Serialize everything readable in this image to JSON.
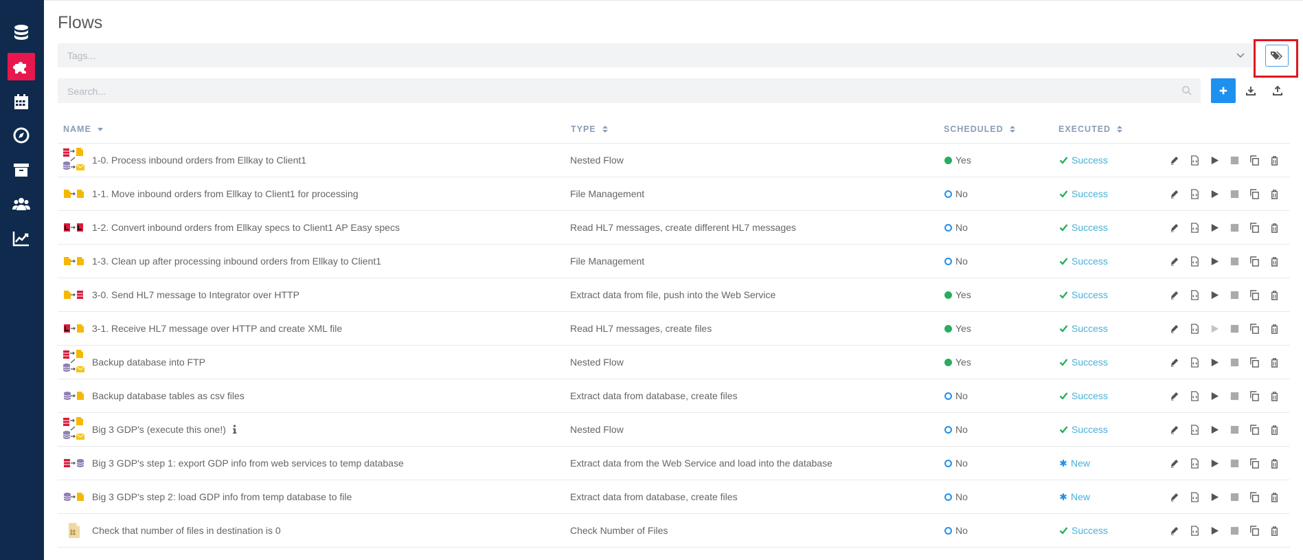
{
  "page": {
    "title": "Flows"
  },
  "sidebar": {
    "items": [
      {
        "name": "nav-databases",
        "icon": "database-icon"
      },
      {
        "name": "nav-flows",
        "icon": "puzzle-icon",
        "active": true
      },
      {
        "name": "nav-schedules",
        "icon": "calendar-icon"
      },
      {
        "name": "nav-monitor",
        "icon": "compass-icon"
      },
      {
        "name": "nav-archive",
        "icon": "archive-icon"
      },
      {
        "name": "nav-users",
        "icon": "users-icon"
      },
      {
        "name": "nav-statistics",
        "icon": "chart-line-icon"
      }
    ]
  },
  "tags": {
    "placeholder": "Tags...",
    "button_icon": "tags-icon"
  },
  "search": {
    "placeholder": "Search...",
    "add_icon": "plus-icon",
    "import_icon": "download-icon",
    "export_icon": "upload-icon"
  },
  "table": {
    "columns": {
      "name": "NAME",
      "type": "TYPE",
      "scheduled": "SCHEDULED",
      "executed": "EXECUTED"
    },
    "rows": [
      {
        "icon": "nested-flow-icon",
        "name": "1-0. Process inbound orders from Ellkay to Client1",
        "type": "Nested Flow",
        "scheduled": "Yes",
        "executed": "Success"
      },
      {
        "icon": "file-to-file-icon",
        "name": "1-1. Move inbound orders from Ellkay to Client1 for processing",
        "type": "File Management",
        "scheduled": "No",
        "executed": "Success"
      },
      {
        "icon": "hl7-to-hl7-icon",
        "name": "1-2. Convert inbound orders from Ellkay specs to Client1 AP Easy specs",
        "type": "Read HL7 messages, create different HL7 messages",
        "scheduled": "No",
        "executed": "Success"
      },
      {
        "icon": "file-to-file-icon",
        "name": "1-3. Clean up after processing inbound orders from Ellkay to Client1",
        "type": "File Management",
        "scheduled": "No",
        "executed": "Success"
      },
      {
        "icon": "file-to-web-icon",
        "name": "3-0. Send HL7 message to Integrator over HTTP",
        "type": "Extract data from file, push into the Web Service",
        "scheduled": "Yes",
        "executed": "Success"
      },
      {
        "icon": "hl7-to-file-icon",
        "name": "3-1. Receive HL7 message over HTTP and create XML file",
        "type": "Read HL7 messages, create files",
        "scheduled": "Yes",
        "executed": "Success"
      },
      {
        "icon": "nested-flow-icon",
        "name": "Backup database into FTP",
        "type": "Nested Flow",
        "scheduled": "Yes",
        "executed": "Success"
      },
      {
        "icon": "db-to-file-icon",
        "name": "Backup database tables as csv files",
        "type": "Extract data from database, create files",
        "scheduled": "No",
        "executed": "Success"
      },
      {
        "icon": "nested-flow-icon",
        "name": "Big 3 GDP's (execute this one!)",
        "type": "Nested Flow",
        "scheduled": "No",
        "executed": "Success",
        "info": true
      },
      {
        "icon": "web-to-db-icon",
        "name": "Big 3 GDP's step 1: export GDP info from web services to temp database",
        "type": "Extract data from the Web Service and load into the database",
        "scheduled": "No",
        "executed": "New"
      },
      {
        "icon": "db-to-file-icon",
        "name": "Big 3 GDP's step 2: load GDP info from temp database to file",
        "type": "Extract data from database, create files",
        "scheduled": "No",
        "executed": "New"
      },
      {
        "icon": "file-count-icon",
        "name": "Check that number of files in destination is 0",
        "type": "Check Number of Files",
        "scheduled": "No",
        "executed": "Success"
      }
    ]
  },
  "colors": {
    "sidebar": "#0f2a4c",
    "active": "#e8174e",
    "primary": "#1e90f0",
    "success": "#27ae60",
    "status_text": "#47b0d8",
    "highlight": "#e0141e"
  }
}
